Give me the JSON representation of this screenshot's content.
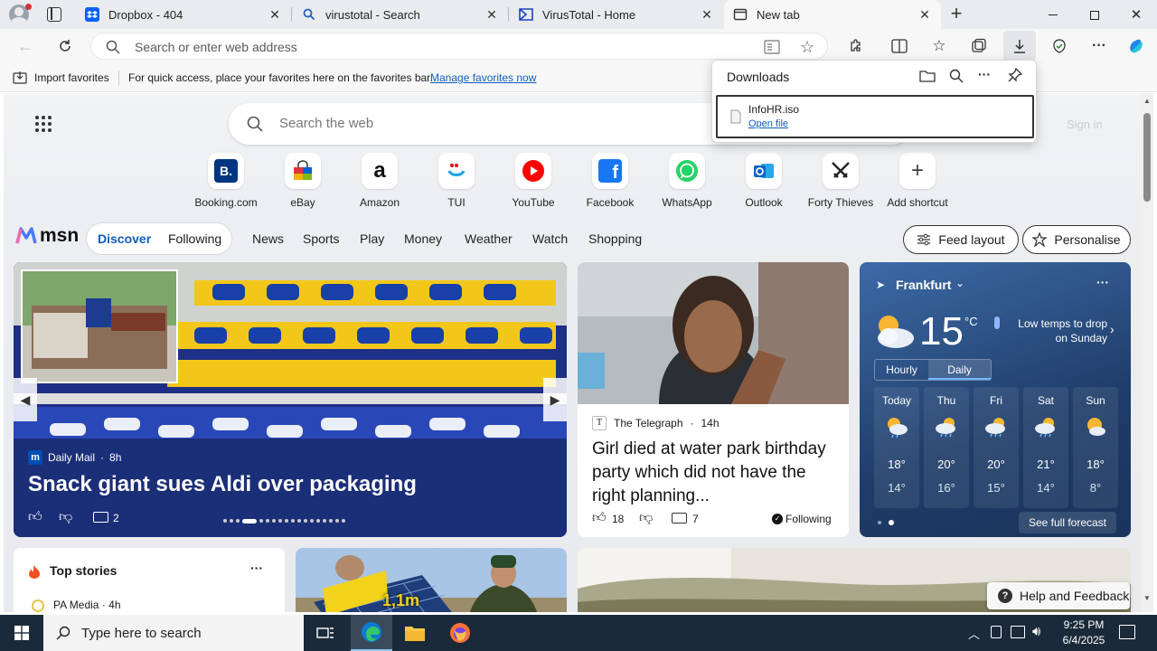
{
  "tabs": [
    {
      "title": "Dropbox - 404",
      "icon": "dropbox-icon"
    },
    {
      "title": "virustotal - Search",
      "icon": "search-icon"
    },
    {
      "title": "VirusTotal - Home",
      "icon": "virustotal-icon"
    },
    {
      "title": "New tab",
      "icon": "newtab-icon"
    }
  ],
  "address": {
    "placeholder": "Search or enter web address"
  },
  "favorites_bar": {
    "import_label": "Import favorites",
    "hint": "For quick access, place your favorites here on the favorites bar.",
    "manage_link": "Manage favorites now"
  },
  "downloads": {
    "title": "Downloads",
    "file_name": "InfoHR.iso",
    "open_link": "Open file"
  },
  "newtab": {
    "search_placeholder": "Search the web",
    "shortcuts": [
      {
        "label": "Booking.com"
      },
      {
        "label": "eBay"
      },
      {
        "label": "Amazon"
      },
      {
        "label": "TUI"
      },
      {
        "label": "YouTube"
      },
      {
        "label": "Facebook"
      },
      {
        "label": "WhatsApp"
      },
      {
        "label": "Outlook"
      },
      {
        "label": "Forty Thieves"
      },
      {
        "label": "Add shortcut"
      }
    ]
  },
  "msn": {
    "brand": "msn",
    "tabs": [
      "Discover",
      "Following"
    ],
    "nav": [
      "News",
      "Sports",
      "Play",
      "Money",
      "Weather",
      "Watch",
      "Shopping"
    ],
    "feed_layout": "Feed layout",
    "personalise": "Personalise"
  },
  "hero": {
    "source": "Daily Mail",
    "age": "8h",
    "headline": "Snack giant sues Aldi over packaging",
    "comments": "2"
  },
  "story2": {
    "source": "The Telegraph",
    "age": "14h",
    "headline": "Girl died at water park birthday party which did not have the right planning...",
    "likes": "18",
    "comments": "7",
    "following": "Following"
  },
  "weather": {
    "city": "Frankfurt",
    "temp": "15",
    "unit": "°C",
    "alert": "Low temps to drop on Sunday",
    "tabs": [
      "Hourly",
      "Daily"
    ],
    "days": [
      {
        "day": "Today",
        "hi": "18°",
        "lo": "14°"
      },
      {
        "day": "Thu",
        "hi": "20°",
        "lo": "16°"
      },
      {
        "day": "Fri",
        "hi": "20°",
        "lo": "15°"
      },
      {
        "day": "Sat",
        "hi": "21°",
        "lo": "14°"
      },
      {
        "day": "Sun",
        "hi": "18°",
        "lo": "8°"
      }
    ],
    "forecast_link": "See full forecast"
  },
  "top_stories": {
    "title": "Top stories",
    "first_source": "PA Media",
    "first_age": "4h"
  },
  "solar_card": {
    "overlay": "1,1m"
  },
  "help": {
    "label": "Help and Feedback"
  },
  "taskbar": {
    "search_placeholder": "Type here to search",
    "time": "9:25 PM",
    "date": "6/4/2025"
  }
}
